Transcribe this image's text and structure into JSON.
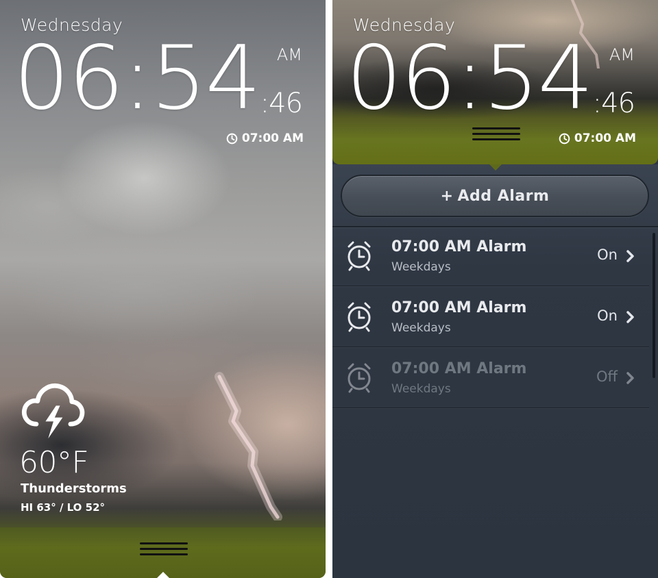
{
  "left_screen": {
    "day": "Wednesday",
    "time": "06:54",
    "ampm": "AM",
    "seconds": ":46",
    "next_alarm": "07:00 AM",
    "weather": {
      "icon": "thunderstorm-cloud-icon",
      "temperature": "60°F",
      "condition": "Thunderstorms",
      "hi_lo": "HI 63° / LO 52°"
    }
  },
  "right_screen": {
    "day": "Wednesday",
    "time": "06:54",
    "ampm": "AM",
    "seconds": ":46",
    "next_alarm": "07:00 AM",
    "add_alarm": {
      "plus": "+",
      "label": "Add Alarm"
    },
    "alarms": [
      {
        "title": "07:00 AM Alarm",
        "repeat": "Weekdays",
        "state": "On"
      },
      {
        "title": "07:00 AM Alarm",
        "repeat": "Weekdays",
        "state": "On"
      },
      {
        "title": "07:00 AM Alarm",
        "repeat": "Weekdays",
        "state": "Off"
      }
    ]
  },
  "colors": {
    "list_background": "#2e3641",
    "grass": "#5e6b1d",
    "text": "#ffffff",
    "disabled_text": "#6f7780"
  }
}
